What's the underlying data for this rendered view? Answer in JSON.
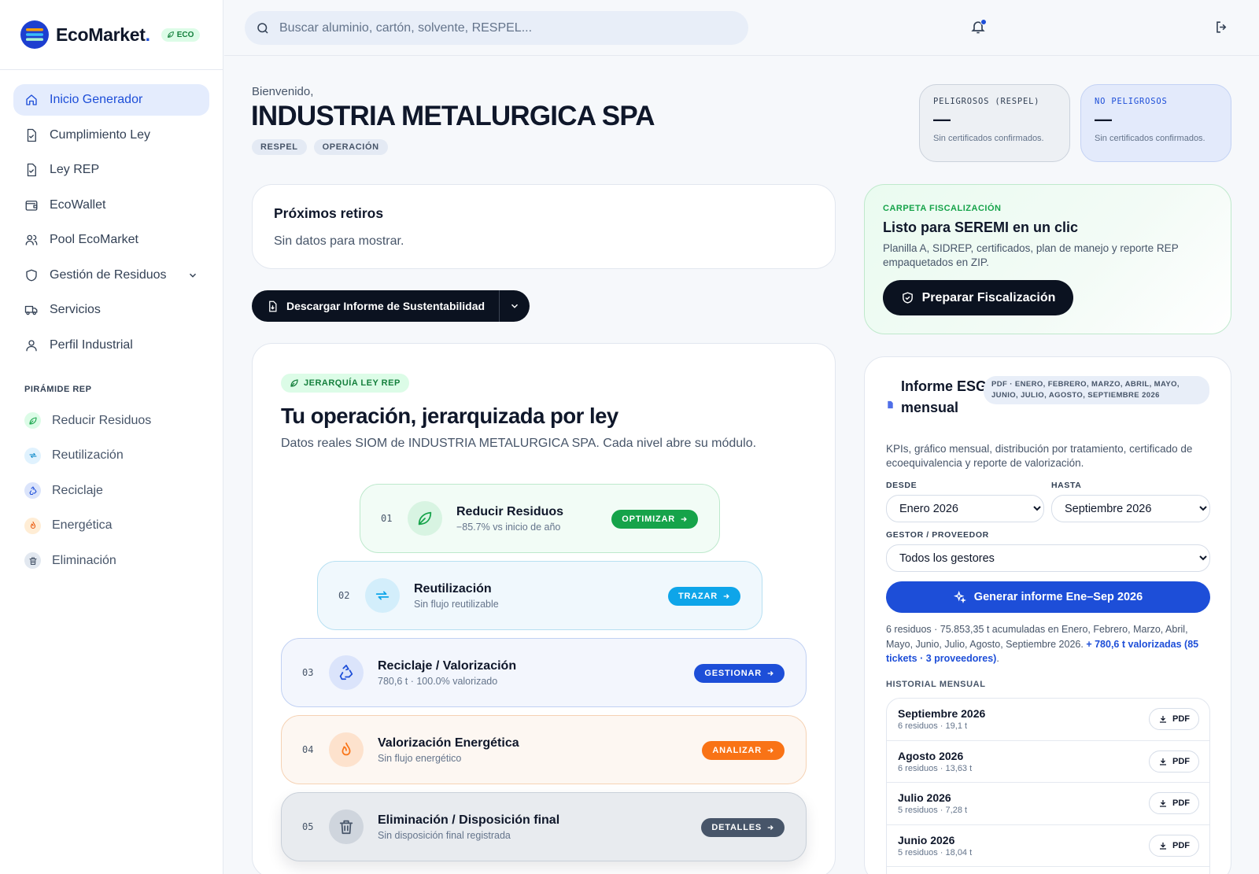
{
  "brand": {
    "name": "EcoMarket",
    "dot": ".",
    "badge": "ECO"
  },
  "sidebar": {
    "items": [
      {
        "label": "Inicio Generador",
        "icon": "home-icon",
        "active": true
      },
      {
        "label": "Cumplimiento Ley",
        "icon": "document-check-icon"
      },
      {
        "label": "Ley REP",
        "icon": "document-check-icon"
      },
      {
        "label": "EcoWallet",
        "icon": "wallet-icon"
      },
      {
        "label": "Pool EcoMarket",
        "icon": "users-icon"
      },
      {
        "label": "Gestión de Residuos",
        "icon": "shield-icon",
        "expandable": true
      },
      {
        "label": "Servicios",
        "icon": "truck-icon"
      },
      {
        "label": "Perfil Industrial",
        "icon": "user-icon"
      }
    ],
    "section_title": "PIRÁMIDE REP",
    "pyramid": [
      {
        "label": "Reducir Residuos",
        "icon": "leaf-icon",
        "color": "#16a34a",
        "bg": "#dcfce7"
      },
      {
        "label": "Reutilización",
        "icon": "repeat-icon",
        "color": "#0284c7",
        "bg": "#e0f2fe"
      },
      {
        "label": "Reciclaje",
        "icon": "recycle-icon",
        "color": "#1d4ed8",
        "bg": "#dbe4fb"
      },
      {
        "label": "Energética",
        "icon": "flame-icon",
        "color": "#ea580c",
        "bg": "#ffedd5"
      },
      {
        "label": "Eliminación",
        "icon": "trash-icon",
        "color": "#475569",
        "bg": "#e2e8f0"
      }
    ]
  },
  "header": {
    "search_placeholder": "Buscar aluminio, cartón, solvente, RESPEL..."
  },
  "welcome": {
    "greeting": "Bienvenido,",
    "company": "INDUSTRIA METALURGICA SPA",
    "tags": [
      "RESPEL",
      "OPERACIÓN"
    ]
  },
  "stats": [
    {
      "title": "PELIGROSOS (RESPEL)",
      "value": "—",
      "sub": "Sin certificados confirmados."
    },
    {
      "title": "NO PELIGROSOS",
      "value": "—",
      "sub": "Sin certificados confirmados."
    }
  ],
  "retiros": {
    "title": "Próximos retiros",
    "empty": "Sin datos para mostrar."
  },
  "download": {
    "label": "Descargar Informe de Sustentabilidad"
  },
  "pyramid_card": {
    "badge": "JERARQUÍA LEY REP",
    "title": "Tu operación, jerarquizada por ley",
    "desc": "Datos reales SIOM de INDUSTRIA METALURGICA SPA. Cada nivel abre su módulo.",
    "levels": [
      {
        "num": "01",
        "name": "Reducir Residuos",
        "sub": "−85.7% vs inicio de año",
        "action": "OPTIMIZAR",
        "icon": "leaf-icon",
        "color": "#16a34a"
      },
      {
        "num": "02",
        "name": "Reutilización",
        "sub": "Sin flujo reutilizable",
        "action": "TRAZAR",
        "icon": "repeat-icon",
        "color": "#0ea5e9"
      },
      {
        "num": "03",
        "name": "Reciclaje / Valorización",
        "sub": "780,6 t · 100.0% valorizado",
        "action": "GESTIONAR",
        "icon": "recycle-icon",
        "color": "#1d4ed8"
      },
      {
        "num": "04",
        "name": "Valorización Energética",
        "sub": "Sin flujo energético",
        "action": "ANALIZAR",
        "icon": "flame-icon",
        "color": "#f97316"
      },
      {
        "num": "05",
        "name": "Eliminación / Disposición final",
        "sub": "Sin disposición final registrada",
        "action": "DETALLES",
        "icon": "trash-icon",
        "color": "#475569"
      }
    ]
  },
  "fiscalizacion": {
    "tag": "CARPETA FISCALIZACIÓN",
    "title": "Listo para SEREMI en un clic",
    "desc": "Planilla A, SIDREP, certificados, plan de manejo y reporte REP empaquetados en ZIP.",
    "button": "Preparar Fiscalización"
  },
  "esg": {
    "title": "Informe ESG mensual",
    "pill": "PDF · ENERO, FEBRERO, MARZO, ABRIL, MAYO, JUNIO, JULIO, AGOSTO, SEPTIEMBRE 2026",
    "desc": "KPIs, gráfico mensual, distribución por tratamiento, certificado de ecoequivalencia y reporte de valorización.",
    "desde_label": "DESDE",
    "desde_value": "Enero 2026",
    "hasta_label": "HASTA",
    "hasta_value": "Septiembre 2026",
    "gestor_label": "GESTOR / PROVEEDOR",
    "gestor_value": "Todos los gestores",
    "button": "Generar informe Ene–Sep 2026",
    "summary": "6 residuos · 75.853,35 t acumuladas en Enero, Febrero, Marzo, Abril, Mayo, Junio, Julio, Agosto, Septiembre 2026. ",
    "summary_hl": "+ 780,6 t valorizadas (85 tickets · 3 proveedores)",
    "summary_end": ".",
    "history_title": "HISTORIAL MENSUAL",
    "pdf_label": "PDF",
    "history": [
      {
        "month": "Septiembre 2026",
        "sub": "6 residuos · 19,1 t"
      },
      {
        "month": "Agosto 2026",
        "sub": "6 residuos · 13,63 t"
      },
      {
        "month": "Julio 2026",
        "sub": "5 residuos · 7,28 t"
      },
      {
        "month": "Junio 2026",
        "sub": "5 residuos · 18,04 t"
      }
    ]
  }
}
